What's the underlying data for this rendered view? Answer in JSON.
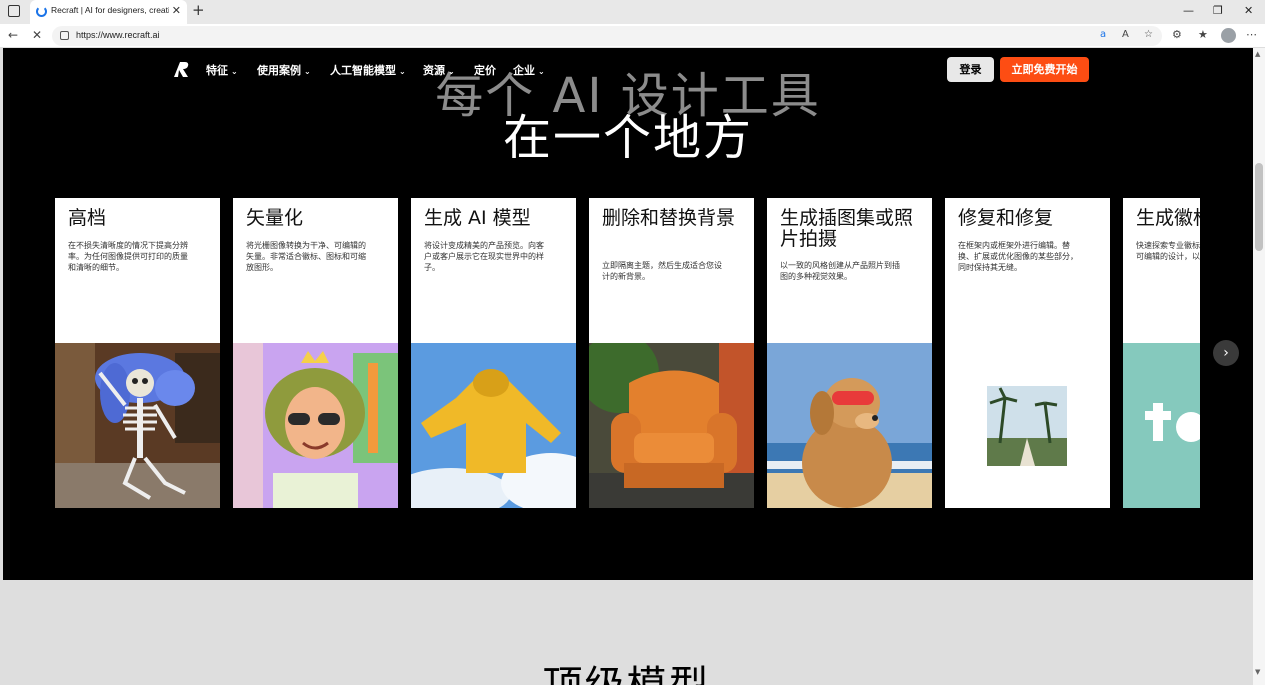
{
  "browser": {
    "tab_title": "Recraft | AI for designers, creative",
    "url": "https://www.recraft.ai",
    "window_controls": {
      "minimize": "—",
      "restore": "❐",
      "close": "✕"
    }
  },
  "nav": {
    "items": [
      {
        "label": "特征",
        "has_dropdown": true
      },
      {
        "label": "使用案例",
        "has_dropdown": true
      },
      {
        "label": "人工智能模型",
        "has_dropdown": true
      },
      {
        "label": "资源",
        "has_dropdown": true
      },
      {
        "label": "定价",
        "has_dropdown": false
      },
      {
        "label": "企业",
        "has_dropdown": true
      }
    ],
    "login_label": "登录",
    "cta_label": "立即免费开始"
  },
  "hero": {
    "title_line1": "每个 AI 设计工具",
    "title_line2": "在一个地方"
  },
  "cards": [
    {
      "title": "高档",
      "desc": "在不损失清晰度的情况下提高分辨率。为任何图像提供可打印的质量和清晰的细节。",
      "image": "skeleton-photo"
    },
    {
      "title": "矢量化",
      "desc": "将光栅图像转换为干净、可编辑的矢量。非常适合徽标、图标和可缩放图形。",
      "image": "vector-portrait-illustration"
    },
    {
      "title": "生成 AI 模型",
      "desc": "将设计变成精美的产品预览。向客户或客户展示它在现实世界中的样子。",
      "image": "yellow-hoodie-sky"
    },
    {
      "title": "删除和替换背景",
      "desc": "立即隔离主题，然后生成适合您设计的新背景。",
      "image": "orange-armchair"
    },
    {
      "title": "生成插图集或照片拍摄",
      "desc": "以一致的风格创建从产品照片到插图的多种视觉效果。",
      "image": "dog-with-goggles-beach"
    },
    {
      "title": "修复和修复",
      "desc": "在框架内或框架外进行编辑。替换、扩展或优化图像的某些部分，同时保持其无缝。",
      "image": "palm-beach-path"
    },
    {
      "title": "生成徽标",
      "desc": "快速探索专业徽标，生成可扩展、可编辑的设计，以捕捉您的品牌。",
      "image": "teal-logo"
    }
  ],
  "carousel": {
    "next_icon": "›"
  },
  "section2": {
    "title": "顶级模型"
  }
}
